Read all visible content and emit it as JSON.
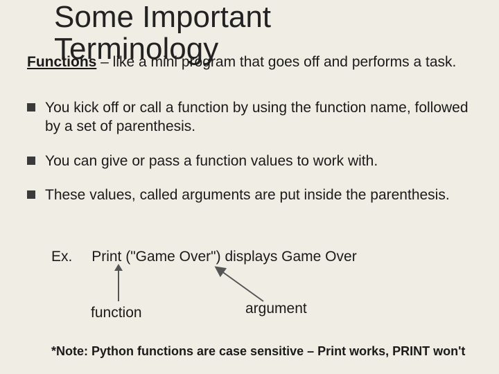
{
  "title": "Some Important Terminology",
  "intro": {
    "term": "Functions",
    "rest": " – like a mini program that goes off and performs a task."
  },
  "bullets": [
    "You kick off or call a function by using the function name, followed by a set of parenthesis.",
    "You can give or pass a function values to work with.",
    "These values, called arguments are put inside the parenthesis."
  ],
  "example": {
    "label": "Ex.",
    "code": "Print (\"Game Over\")  displays Game Over"
  },
  "annot": {
    "function": "function",
    "argument": "argument"
  },
  "note": "*Note: Python functions are case sensitive – Print works, PRINT won't"
}
